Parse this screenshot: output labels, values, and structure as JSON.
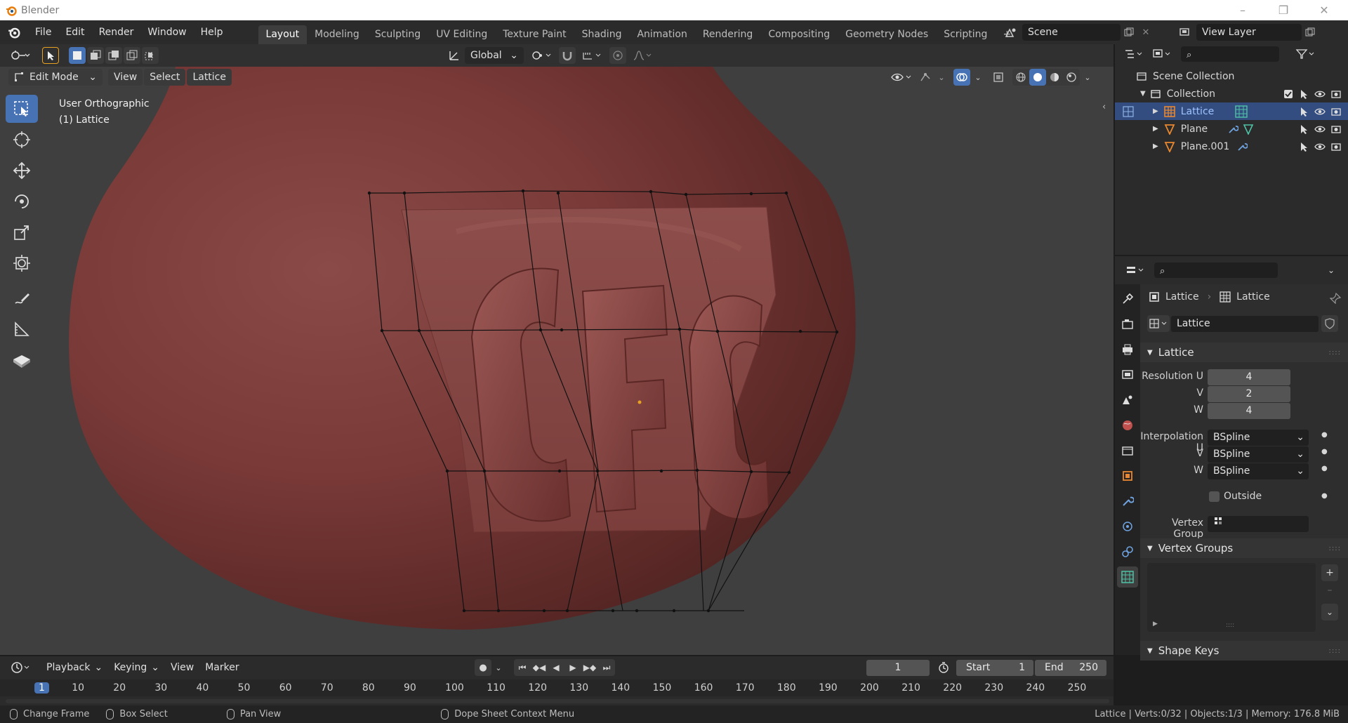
{
  "window": {
    "title": "Blender",
    "minimize": "–",
    "maximize": "❐",
    "close": "✕"
  },
  "menu": [
    "File",
    "Edit",
    "Render",
    "Window",
    "Help"
  ],
  "workspaces": [
    "Layout",
    "Modeling",
    "Sculpting",
    "UV Editing",
    "Texture Paint",
    "Shading",
    "Animation",
    "Rendering",
    "Compositing",
    "Geometry Nodes",
    "Scripting"
  ],
  "workspace_add": "+",
  "scene": {
    "name": "Scene",
    "view_layer": "View Layer"
  },
  "viewport": {
    "orientation": "Global",
    "mode": "Edit Mode",
    "menus": [
      "View",
      "Select",
      "Lattice"
    ],
    "overlay_text_1": "User Orthographic",
    "overlay_text_2": "(1) Lattice"
  },
  "outliner": {
    "scene_collection": "Scene Collection",
    "collection": "Collection",
    "items": [
      "Lattice",
      "Plane",
      "Plane.001"
    ]
  },
  "properties": {
    "breadcrumb_object": "Lattice",
    "breadcrumb_data": "Lattice",
    "datablock": "Lattice",
    "panel_lattice": "Lattice",
    "resolution_u_label": "Resolution U",
    "v_label": "V",
    "w_label": "W",
    "resolution_u": "4",
    "resolution_v": "2",
    "resolution_w": "4",
    "interp_u_label": "Interpolation U",
    "interp_u": "BSpline",
    "interp_v": "BSpline",
    "interp_w": "BSpline",
    "outside_label": "Outside",
    "vertex_group_label": "Vertex Group",
    "panel_vertex_groups": "Vertex Groups",
    "panel_shape_keys": "Shape Keys"
  },
  "timeline": {
    "menus": [
      "Playback",
      "Keying",
      "View",
      "Marker"
    ],
    "current_frame": "1",
    "start_label": "Start",
    "start": "1",
    "end_label": "End",
    "end": "250",
    "ruler": [
      "1",
      "10",
      "20",
      "30",
      "40",
      "50",
      "60",
      "70",
      "80",
      "90",
      "100",
      "110",
      "120",
      "130",
      "140",
      "150",
      "160",
      "170",
      "180",
      "190",
      "200",
      "210",
      "220",
      "230",
      "240",
      "250"
    ]
  },
  "status": {
    "change_frame": "Change Frame",
    "box_select": "Box Select",
    "pan_view": "Pan View",
    "context_menu": "Dope Sheet Context Menu",
    "stats": "Lattice | Verts:0/32 | Objects:1/3 | Memory: 176.8 MiB"
  },
  "colors": {
    "accent": "#4772b3",
    "selected_row": "#334d80",
    "object_orange": "#e8872f",
    "lattice_teal": "#4ec3a6"
  }
}
